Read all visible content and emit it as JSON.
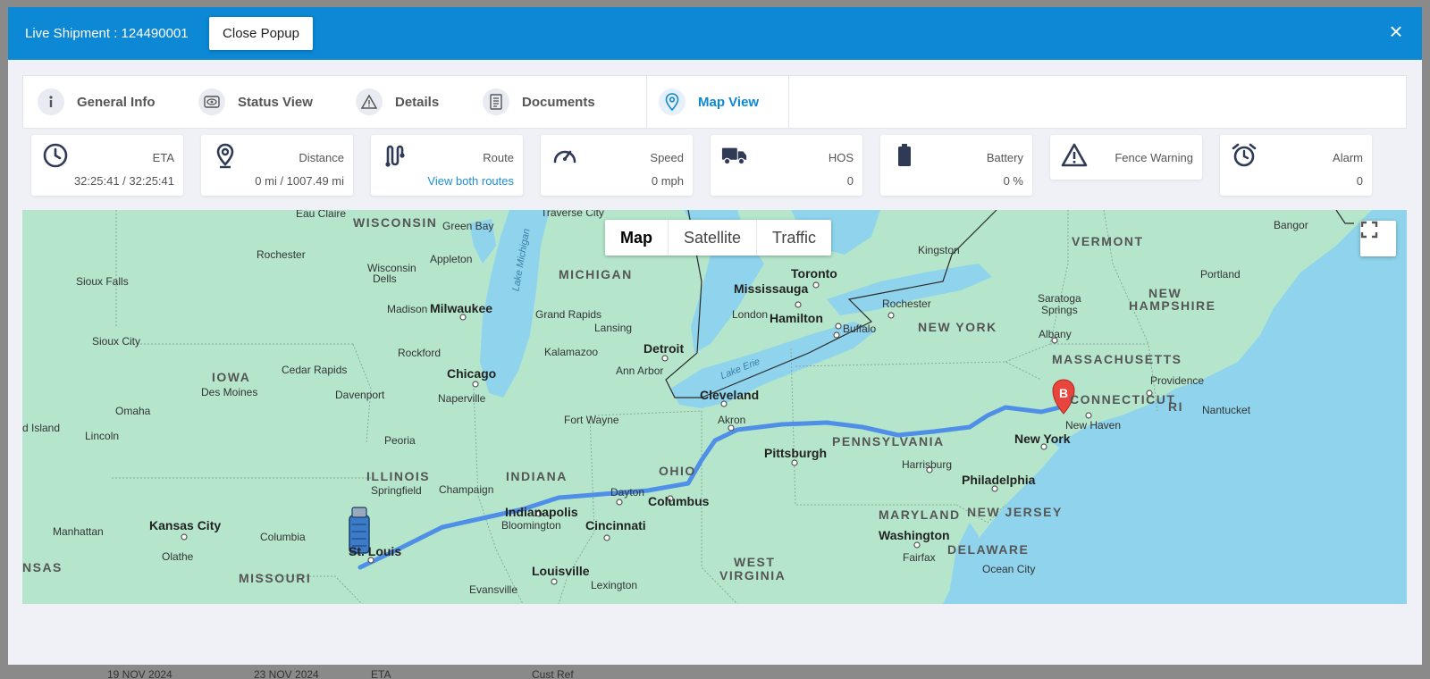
{
  "backdrop": {
    "date1": "19 NOV 2024",
    "date2": "23 NOV 2024",
    "col_eta": "ETA",
    "col_cust": "Cust Ref"
  },
  "header": {
    "title": "Live Shipment : 124490001",
    "close_popup_label": "Close Popup",
    "close_icon": "×"
  },
  "tabs": [
    {
      "label": "General Info",
      "icon": "info-icon"
    },
    {
      "label": "Status View",
      "icon": "eye-icon"
    },
    {
      "label": "Details",
      "icon": "warning-icon"
    },
    {
      "label": "Documents",
      "icon": "document-icon"
    },
    {
      "label": "Map View",
      "icon": "location-pin-icon",
      "active": true
    }
  ],
  "stats": {
    "eta": {
      "label": "ETA",
      "value": "32:25:41 / 32:25:41"
    },
    "distance": {
      "label": "Distance",
      "value": "0 mi / 1007.49 mi"
    },
    "route": {
      "label": "Route",
      "link": "View both routes"
    },
    "speed": {
      "label": "Speed",
      "value": "0 mph"
    },
    "hos": {
      "label": "HOS",
      "value": "0"
    },
    "battery": {
      "label": "Battery",
      "value": "0 %"
    },
    "fence": {
      "label": "Fence Warning"
    },
    "alarm": {
      "label": "Alarm",
      "value": "0"
    }
  },
  "map": {
    "type_buttons": {
      "map": "Map",
      "satellite": "Satellite",
      "traffic": "Traffic"
    },
    "destination_marker": "B",
    "labels": {
      "wisconsin": "WISCONSIN",
      "michigan": "MICHIGAN",
      "iowa": "IOWA",
      "illinois": "ILLINOIS",
      "indiana": "INDIANA",
      "ohio": "OHIO",
      "missouri": "MISSOURI",
      "kansas": "NSAS",
      "pennsylvania": "PENNSYLVANIA",
      "new_york_state": "NEW YORK",
      "vermont": "VERMONT",
      "new_hampshire": "NEW",
      "new_hampshire2": "HAMPSHIRE",
      "massachusetts": "MASSACHUSETTS",
      "connecticut": "CONNECTICUT",
      "ri": "RI",
      "maryland": "MARYLAND",
      "new_jersey": "NEW JERSEY",
      "delaware": "DELAWARE",
      "west_virginia": "WEST",
      "west_virginia2": "VIRGINIA",
      "lake_michigan": "Lake Michigan",
      "lake_erie": "Lake Erie",
      "milwaukee": "Milwaukee",
      "chicago": "Chicago",
      "detroit": "Detroit",
      "toronto": "Toronto",
      "mississauga": "Mississauga",
      "hamilton": "Hamilton",
      "buffalo": "Buffalo",
      "rochester_ny": "Rochester",
      "cleveland": "Cleveland",
      "akron": "Akron",
      "pittsburgh": "Pittsburgh",
      "columbus": "Columbus",
      "dayton": "Dayton",
      "cincinnati": "Cincinnati",
      "indianapolis": "Indianapolis",
      "st_louis": "St. Louis",
      "louisville": "Louisville",
      "kansas_city": "Kansas City",
      "philadelphia": "Philadelphia",
      "new_york": "New York",
      "washington": "Washington",
      "new_haven": "New Haven",
      "providence": "Providence",
      "albany": "Albany",
      "harrisburg": "Harrisburg",
      "green_bay": "Green Bay",
      "appleton": "Appleton",
      "madison": "Madison",
      "rochester_mn": "Rochester",
      "sioux_falls": "Sioux Falls",
      "sioux_city": "Sioux City",
      "des_moines": "Des Moines",
      "cedar_rapids": "Cedar Rapids",
      "davenport": "Davenport",
      "omaha": "Omaha",
      "lincoln": "Lincoln",
      "rockford": "Rockford",
      "naperville": "Naperville",
      "peoria": "Peoria",
      "springfield": "Springfield",
      "champaign": "Champaign",
      "fort_wayne": "Fort Wayne",
      "kalamazoo": "Kalamazoo",
      "grand_rapids": "Grand Rapids",
      "lansing": "Lansing",
      "ann_arbor": "Ann Arbor",
      "london": "London",
      "kingston": "Kingston",
      "bangor": "Bangor",
      "portland": "Portland",
      "saratoga": "Saratoga",
      "springs": "Springs",
      "nantucket": "Nantucket",
      "fairfax": "Fairfax",
      "ocean_city": "Ocean City",
      "lexington": "Lexington",
      "evansville": "Evansville",
      "bloomington": "Bloomington",
      "columbia": "Columbia",
      "olathe": "Olathe",
      "manhattan": "Manhattan",
      "traverse_city": "Traverse City",
      "eau_claire": "Eau Claire",
      "wisconsin_dells": "Wisconsin",
      "dells": "Dells",
      "grand_island": "d Island"
    }
  }
}
